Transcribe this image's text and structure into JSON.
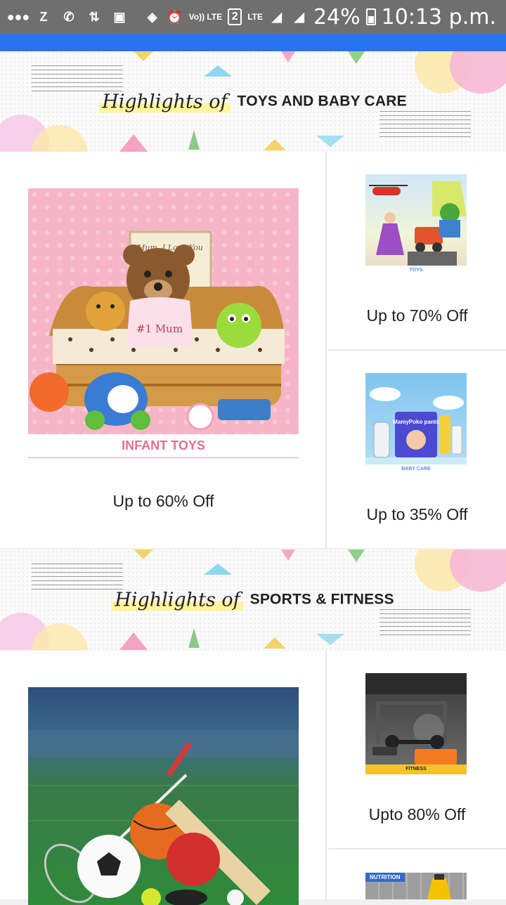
{
  "status_bar": {
    "battery": "24%",
    "time": "10:13 p.m.",
    "sim_slot": "2",
    "network": "LTE",
    "volte": "Vo)) LTE"
  },
  "sections": [
    {
      "script_title": "Highlights of",
      "category": "TOYS AND BABY CARE",
      "featured": {
        "label": "INFANT TOYS",
        "offer": "Up to 60% Off"
      },
      "side": [
        {
          "caption": "TOYS",
          "offer": "Up to 70% Off"
        },
        {
          "caption": "BABY CARE",
          "offer": "Up to 35% Off"
        }
      ]
    },
    {
      "script_title": "Highlights of",
      "category": "SPORTS & FITNESS",
      "side": [
        {
          "caption": "FITNESS",
          "offer": "Upto 80% Off"
        },
        {
          "caption": "NUTRITION"
        }
      ]
    }
  ],
  "images": {
    "infant_tag": "Mum, I Love You",
    "infant_bear": "#1 Mum",
    "babycare_brand": "MamyPoko pants"
  },
  "colors": {
    "accent_blue": "#2874f0",
    "status_gray": "#6f6f6f",
    "infant_pink": "#e0718e",
    "highlight_yellow": "#fff59d"
  }
}
